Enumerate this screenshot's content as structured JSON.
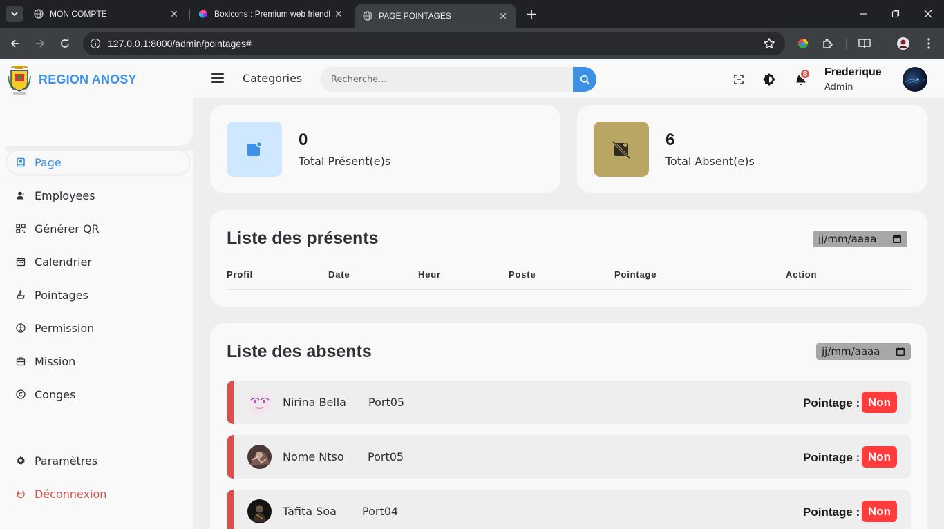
{
  "browser": {
    "tabs": [
      {
        "title": "MON COMPTE",
        "active": false
      },
      {
        "title": "Boxicons : Premium web friendl",
        "active": false
      },
      {
        "title": "PAGE POINTAGES",
        "active": true
      }
    ],
    "url": "127.0.0.1:8000/admin/pointages#"
  },
  "sidebar": {
    "brand": "REGION ANOSY",
    "items": [
      {
        "label": "Page",
        "icon": "dashboard-icon",
        "active": true
      },
      {
        "label": "Employees",
        "icon": "user-icon"
      },
      {
        "label": "Générer QR",
        "icon": "qr-icon"
      },
      {
        "label": "Calendrier",
        "icon": "calendar-icon"
      },
      {
        "label": "Pointages",
        "icon": "pointer-icon"
      },
      {
        "label": "Permission",
        "icon": "accessibility-icon"
      },
      {
        "label": "Mission",
        "icon": "briefcase-icon"
      },
      {
        "label": "Conges",
        "icon": "copyright-icon"
      }
    ],
    "bottom": [
      {
        "label": "Paramètres",
        "icon": "gear-icon"
      },
      {
        "label": "Déconnexion",
        "icon": "logout-icon"
      }
    ]
  },
  "topbar": {
    "categories_label": "Categories",
    "search_placeholder": "Recherche...",
    "notification_count": "8",
    "user_name": "Frederique",
    "user_role": "Admin"
  },
  "stats": {
    "present": {
      "value": "0",
      "label": "Total Présent(e)s",
      "color": "#cfe8ff"
    },
    "absent": {
      "value": "6",
      "label": "Total Absent(e)s",
      "color": "#b9a665"
    }
  },
  "present_list": {
    "title": "Liste des présents",
    "date_placeholder": "jj/mm/aaaa",
    "columns": [
      "Profil",
      "Date",
      "Heur",
      "Poste",
      "Pointage",
      "Action"
    ]
  },
  "absent_list": {
    "title": "Liste des absents",
    "date_placeholder": "jj/mm/aaaa",
    "rows": [
      {
        "name": "Nirina Bella",
        "poste": "Port05",
        "pointage_label": "Pointage :",
        "status": "Non"
      },
      {
        "name": "Nome Ntso",
        "poste": "Port05",
        "pointage_label": "Pointage :",
        "status": "Non"
      },
      {
        "name": "Tafita Soa",
        "poste": "Port04",
        "pointage_label": "Pointage :",
        "status": "Non"
      }
    ]
  },
  "colors": {
    "accent": "#3c91e6",
    "danger": "#db504a",
    "status_non": "#ff3b3b"
  }
}
